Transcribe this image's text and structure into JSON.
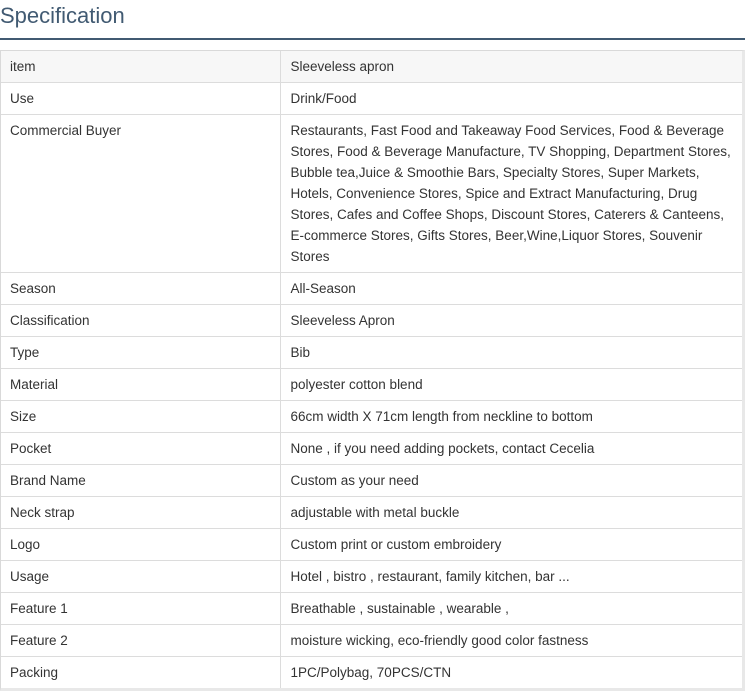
{
  "page": {
    "title": "Specification"
  },
  "spec": {
    "rows": [
      {
        "key": "item",
        "value": "Sleeveless apron"
      },
      {
        "key": "Use",
        "value": "Drink/Food"
      },
      {
        "key": "Commercial Buyer",
        "value": "Restaurants, Fast Food and Takeaway Food Services, Food & Beverage Stores, Food & Beverage Manufacture, TV Shopping, Department Stores, Bubble tea,Juice & Smoothie Bars, Specialty Stores, Super Markets, Hotels, Convenience Stores, Spice and Extract Manufacturing, Drug Stores, Cafes and Coffee Shops, Discount Stores, Caterers & Canteens, E-commerce Stores, Gifts Stores, Beer,Wine,Liquor Stores, Souvenir Stores"
      },
      {
        "key": "Season",
        "value": "All-Season"
      },
      {
        "key": "Classification",
        "value": "Sleeveless Apron"
      },
      {
        "key": "Type",
        "value": "Bib"
      },
      {
        "key": "Material",
        "value": "polyester cotton blend"
      },
      {
        "key": "Size",
        "value": "66cm width X 71cm length from neckline to bottom"
      },
      {
        "key": "Pocket",
        "value": "None , if you need adding pockets, contact Cecelia"
      },
      {
        "key": "Brand Name",
        "value": "Custom as your need"
      },
      {
        "key": "Neck strap",
        "value": "adjustable with metal buckle"
      },
      {
        "key": "Logo",
        "value": "Custom print or custom embroidery"
      },
      {
        "key": "Usage",
        "value": "Hotel , bistro , restaurant, family kitchen, bar ..."
      },
      {
        "key": "Feature 1",
        "value": "Breathable , sustainable , wearable ,"
      },
      {
        "key": "Feature 2",
        "value": "moisture wicking, eco-friendly good color fastness"
      },
      {
        "key": "Packing",
        "value": "1PC/Polybag, 70PCS/CTN"
      }
    ]
  },
  "colors": {
    "title": "#415a72",
    "border": "#dcdcdc",
    "header_row_bg": "#f7f7f7"
  }
}
